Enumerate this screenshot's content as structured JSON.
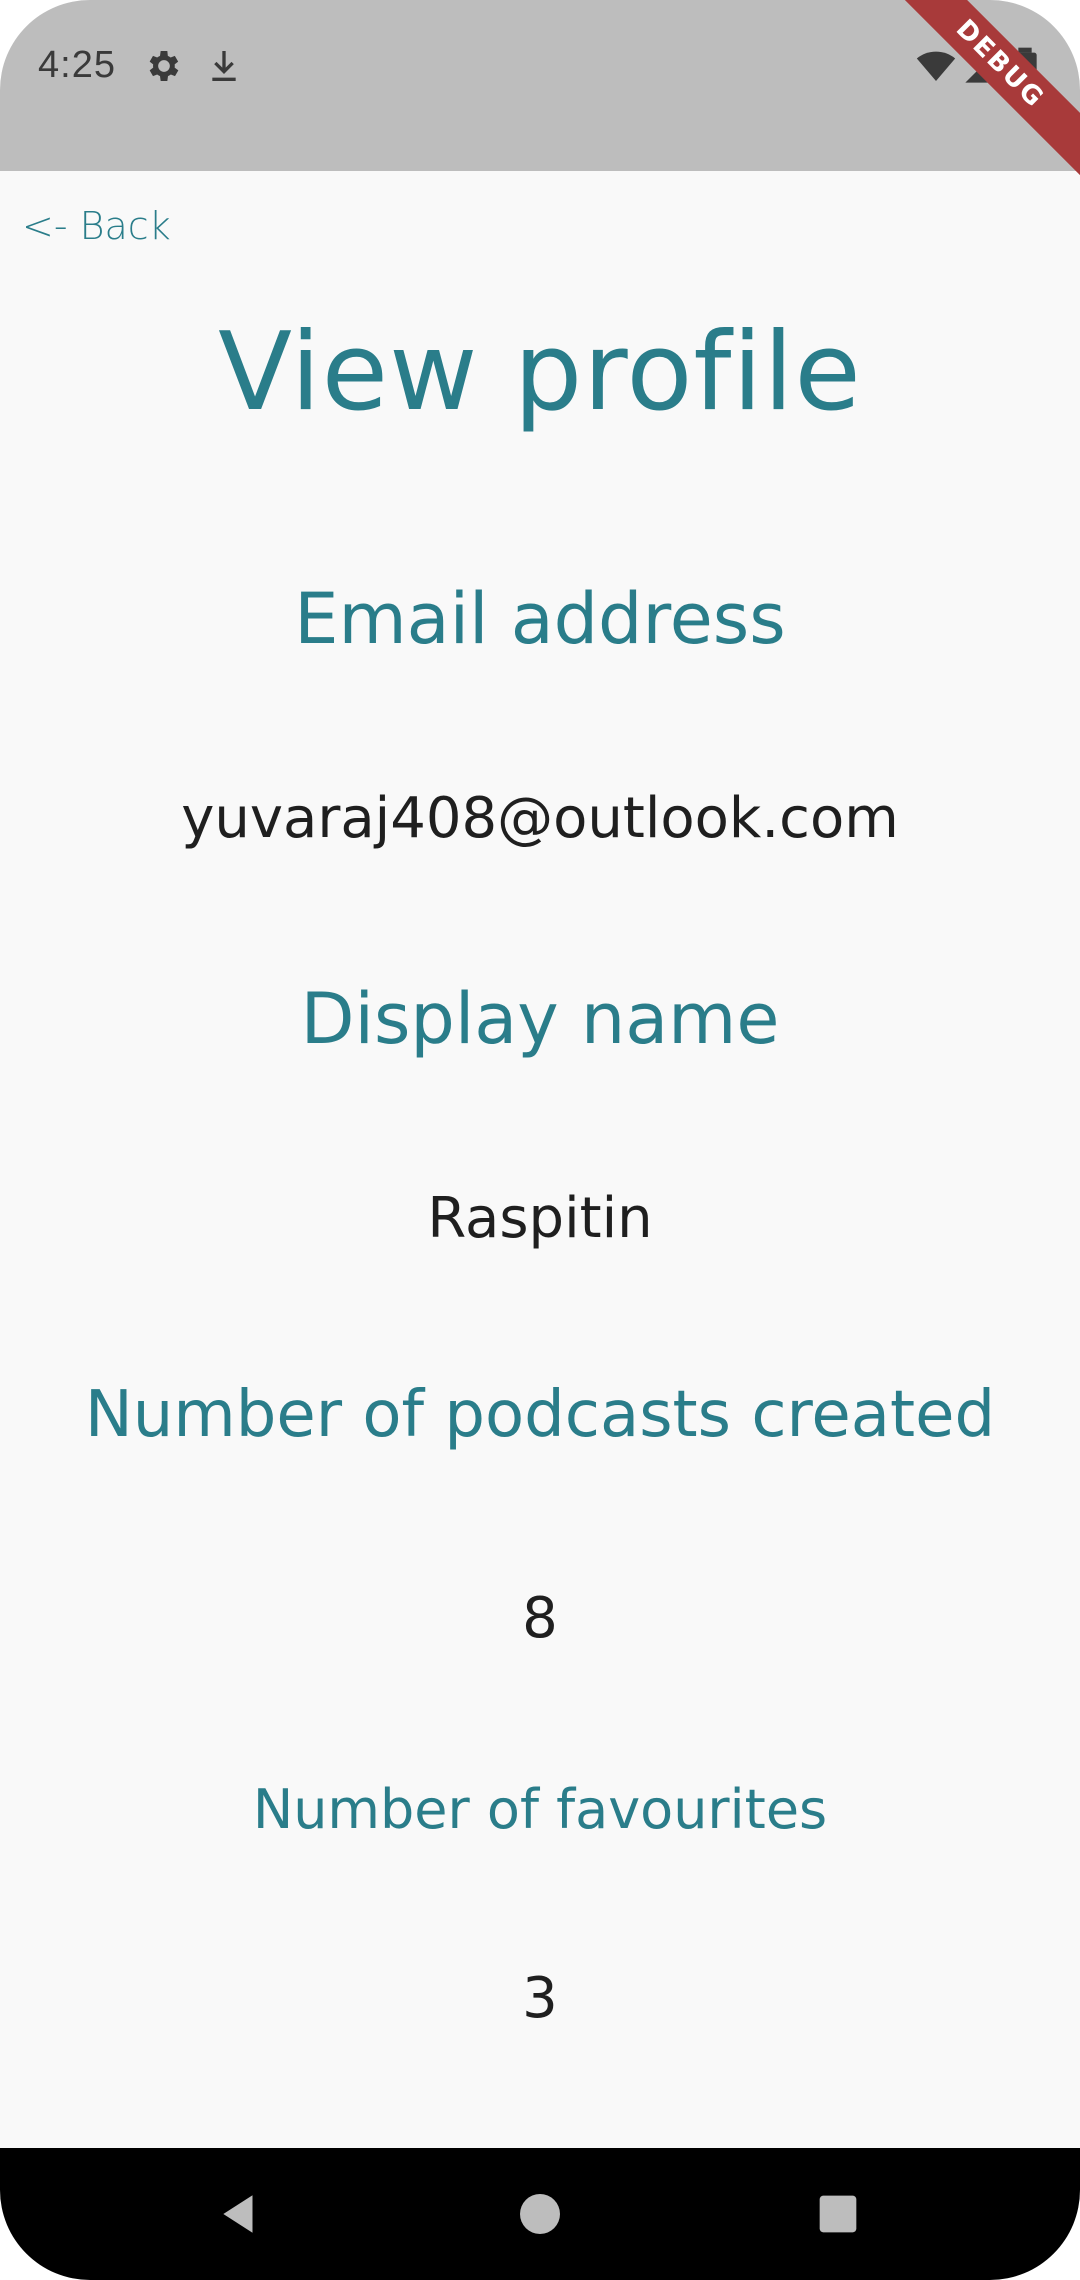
{
  "status_bar": {
    "time": "4:25",
    "icons": [
      "gear-icon",
      "download-icon",
      "wifi-icon",
      "signal-icon",
      "battery-icon"
    ]
  },
  "debug_banner": {
    "label": "DEBUG",
    "color": "#a83a3a"
  },
  "header": {
    "back_label": "<- Back",
    "title": "View profile"
  },
  "profile": {
    "email_label": "Email address",
    "email_value": "yuvaraj408@outlook.com",
    "display_name_label": "Display name",
    "display_name_value": "Raspitin",
    "podcasts_label": "Number of podcasts created",
    "podcasts_value": "8",
    "favourites_label": "Number of favourites",
    "favourites_value": "3"
  },
  "nav_bar": {
    "buttons": [
      "back-triangle-icon",
      "home-circle-icon",
      "recents-square-icon"
    ]
  },
  "colors": {
    "accent": "#2a7d8a",
    "status_bar_bg": "#bdbdbd",
    "page_bg": "#f9f9f9",
    "text": "#1f1f1f"
  }
}
